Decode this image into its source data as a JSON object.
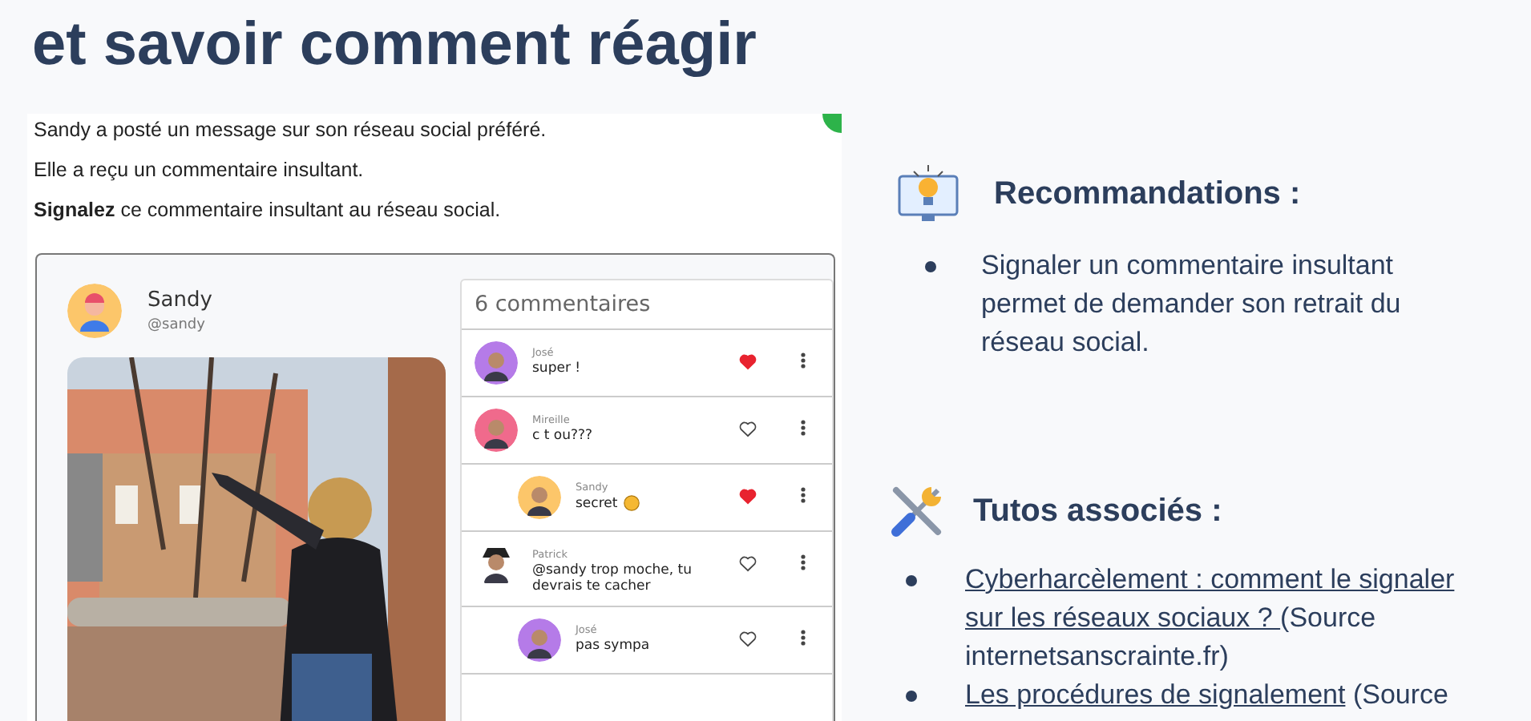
{
  "title": "et savoir comment réagir",
  "intro": [
    "Sandy a posté un message sur son réseau social préféré.",
    "Elle a reçu un commentaire insultant.",
    "**Signalez** ce commentaire insultant au réseau social."
  ],
  "post": {
    "author": "Sandy",
    "handle": "@sandy"
  },
  "comments_header": "6 commentaires",
  "comments": [
    {
      "author": "José",
      "text": "super !",
      "liked": true,
      "color": "#b57be8"
    },
    {
      "author": "Mireille",
      "text": "c t ou???",
      "liked": false,
      "color": "#f06a8c",
      "children": [
        {
          "author": "Sandy",
          "text": "secret",
          "emoji": true,
          "liked": true,
          "color": "#fcc66a"
        }
      ]
    },
    {
      "author": "Patrick",
      "text": "@sandy trop moche, tu devrais te cacher",
      "liked": false,
      "children": [
        {
          "author": "José",
          "text": "pas sympa",
          "liked": false,
          "color": "#b57be8"
        }
      ]
    }
  ],
  "recommendations": {
    "heading": "Recommandations :",
    "items": [
      "Signaler un commentaire insultant permet de demander son retrait du réseau social."
    ]
  },
  "tutorials": {
    "heading": "Tutos associés :",
    "items": [
      {
        "link": "Cyberharcèlement : comment le signaler sur les réseaux sociaux ? ",
        "source": "(Source internetsanscrainte.fr)"
      },
      {
        "link": "Les procédures de signalement",
        "source": "(Source"
      }
    ]
  }
}
